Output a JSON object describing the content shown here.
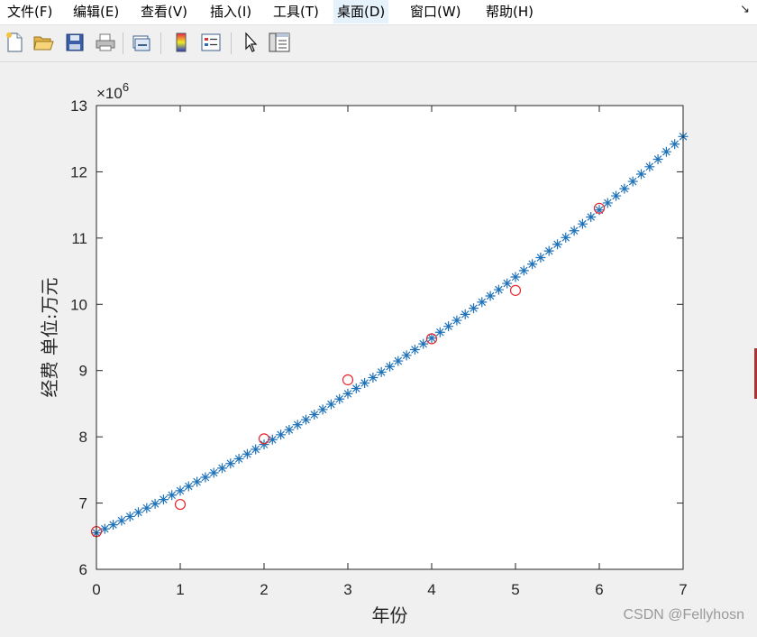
{
  "menubar": {
    "items": [
      {
        "label": "文件(F)"
      },
      {
        "label": "编辑(E)"
      },
      {
        "label": "查看(V)"
      },
      {
        "label": "插入(I)"
      },
      {
        "label": "工具(T)"
      },
      {
        "label": "桌面(D)"
      },
      {
        "label": "窗口(W)"
      },
      {
        "label": "帮助(H)"
      }
    ],
    "corner_icon": "dock-arrow-icon"
  },
  "toolbar": {
    "buttons": [
      "new-figure-icon",
      "open-file-icon",
      "save-icon",
      "print-icon",
      "link-plot-icon",
      "insert-colorbar-icon",
      "insert-legend-icon",
      "edit-plot-pointer-icon",
      "property-inspector-icon"
    ]
  },
  "watermark": "CSDN @Fellyhosn",
  "chart_data": {
    "type": "scatter",
    "title": "",
    "xlabel": "年份",
    "ylabel": "经费 单位:万元",
    "xlim": [
      0,
      7
    ],
    "ylim": [
      6,
      13
    ],
    "y_exponent_label": "×10",
    "y_exponent": "6",
    "xticks": [
      0,
      1,
      2,
      3,
      4,
      5,
      6,
      7
    ],
    "yticks": [
      6,
      7,
      8,
      9,
      10,
      11,
      12,
      13
    ],
    "grid": false,
    "series": [
      {
        "marker": "circle",
        "color": "#e8262a",
        "x": [
          0,
          1,
          2,
          3,
          4,
          5,
          6
        ],
        "y": [
          6.57,
          6.98,
          7.97,
          8.86,
          9.48,
          10.21,
          11.45
        ]
      },
      {
        "marker": "asterisk",
        "color": "#1f72b8",
        "x_start": 0,
        "x_end": 7,
        "x_step": 0.1,
        "fit": {
          "type": "exponential",
          "a": 6.55,
          "b": 0.0927
        }
      }
    ]
  }
}
